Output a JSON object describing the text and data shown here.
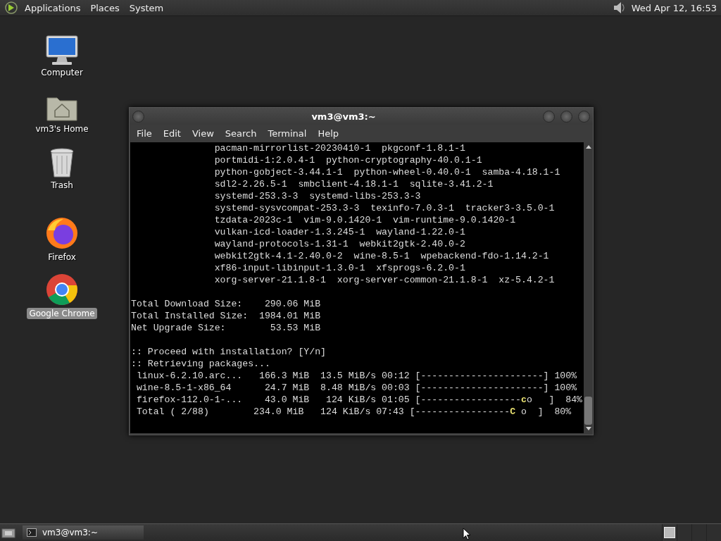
{
  "top_panel": {
    "menus": [
      "Applications",
      "Places",
      "System"
    ],
    "clock": "Wed Apr 12, 16:53"
  },
  "desktop_icons": [
    {
      "kind": "computer",
      "label": "Computer",
      "selected": false
    },
    {
      "kind": "home",
      "label": "vm3's Home",
      "selected": false
    },
    {
      "kind": "trash",
      "label": "Trash",
      "selected": false
    },
    {
      "kind": "firefox",
      "label": "Firefox",
      "selected": false
    },
    {
      "kind": "chrome",
      "label": "Google Chrome",
      "selected": true
    }
  ],
  "terminal": {
    "title": "vm3@vm3:~",
    "menu": [
      "File",
      "Edit",
      "View",
      "Search",
      "Terminal",
      "Help"
    ],
    "lines": [
      {
        "kind": "text",
        "text": "               pacman-mirrorlist-20230410-1  pkgconf-1.8.1-1"
      },
      {
        "kind": "text",
        "text": "               portmidi-1:2.0.4-1  python-cryptography-40.0.1-1"
      },
      {
        "kind": "text",
        "text": "               python-gobject-3.44.1-1  python-wheel-0.40.0-1  samba-4.18.1-1"
      },
      {
        "kind": "text",
        "text": "               sdl2-2.26.5-1  smbclient-4.18.1-1  sqlite-3.41.2-1"
      },
      {
        "kind": "text",
        "text": "               systemd-253.3-3  systemd-libs-253.3-3"
      },
      {
        "kind": "text",
        "text": "               systemd-sysvcompat-253.3-3  texinfo-7.0.3-1  tracker3-3.5.0-1"
      },
      {
        "kind": "text",
        "text": "               tzdata-2023c-1  vim-9.0.1420-1  vim-runtime-9.0.1420-1"
      },
      {
        "kind": "text",
        "text": "               vulkan-icd-loader-1.3.245-1  wayland-1.22.0-1"
      },
      {
        "kind": "text",
        "text": "               wayland-protocols-1.31-1  webkit2gtk-2.40.0-2"
      },
      {
        "kind": "text",
        "text": "               webkit2gtk-4.1-2.40.0-2  wine-8.5-1  wpebackend-fdo-1.14.2-1"
      },
      {
        "kind": "text",
        "text": "               xf86-input-libinput-1.3.0-1  xfsprogs-6.2.0-1"
      },
      {
        "kind": "text",
        "text": "               xorg-server-21.1.8-1  xorg-server-common-21.1.8-1  xz-5.4.2-1"
      },
      {
        "kind": "blank"
      },
      {
        "kind": "text",
        "text": "Total Download Size:    290.06 MiB"
      },
      {
        "kind": "text",
        "text": "Total Installed Size:  1984.01 MiB"
      },
      {
        "kind": "text",
        "text": "Net Upgrade Size:        53.53 MiB"
      },
      {
        "kind": "blank"
      },
      {
        "kind": "text",
        "text": ":: Proceed with installation? [Y/n]"
      },
      {
        "kind": "text",
        "text": ":: Retrieving packages..."
      },
      {
        "kind": "progress",
        "before": " linux-6.2.10.arc...   166.3 MiB  13.5 MiB/s 00:12 [----------------------] 100%"
      },
      {
        "kind": "progress",
        "before": " wine-8.5-1-x86_64      24.7 MiB  8.48 MiB/s 00:03 [----------------------] 100%"
      },
      {
        "kind": "progress",
        "before": " firefox-112.0-1-...    43.0 MiB   124 KiB/s 01:05 [------------------",
        "pacman": "c",
        "after": "o   ]  84%"
      },
      {
        "kind": "progress",
        "before": " Total ( 2/88)        234.0 MiB   124 KiB/s 07:43 [-----------------",
        "pacman": "C",
        "after": " o  ]  80%"
      }
    ]
  },
  "taskbar": {
    "tasks": [
      {
        "label": "vm3@vm3:~",
        "selected": false
      }
    ],
    "workspaces": [
      {
        "selected": true
      },
      {
        "selected": false
      },
      {
        "selected": false
      },
      {
        "selected": false
      }
    ]
  }
}
